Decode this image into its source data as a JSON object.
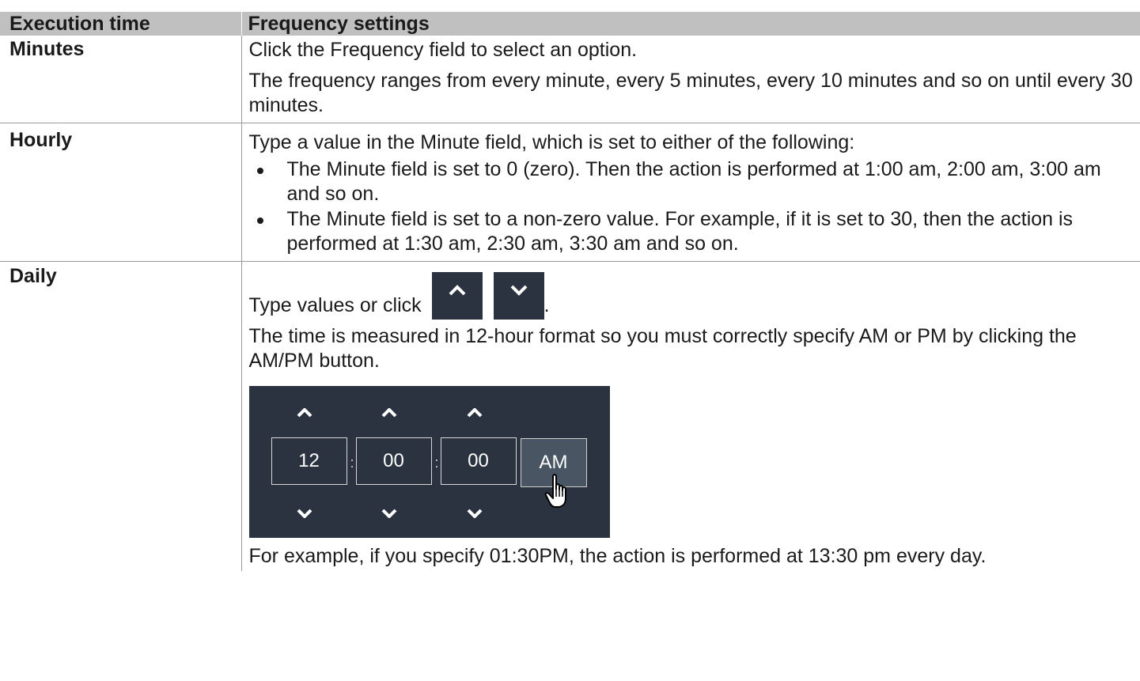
{
  "table": {
    "headers": [
      "Execution time",
      "Frequency settings"
    ],
    "rows": {
      "minutes": {
        "label": "Minutes",
        "p1": "Click the Frequency field to select an option.",
        "p2": "The frequency ranges from every minute, every 5 minutes, every 10 minutes and so on until every 30 minutes."
      },
      "hourly": {
        "label": "Hourly",
        "p1": "Type a value in the Minute field, which is set to either of the following:",
        "bullets": [
          "The Minute field is set to 0 (zero). Then the action is performed at 1:00 am, 2:00 am, 3:00 am and so on.",
          "The Minute field is set to a non-zero value. For example, if it is set to 30, then the action is performed at 1:30 am, 2:30 am, 3:30 am and so on."
        ]
      },
      "daily": {
        "label": "Daily",
        "p1_prefix": "Type values or click",
        "p1_suffix": ".",
        "p2": "The time is measured in 12-hour format so you must correctly specify AM or PM by clicking the AM/PM button.",
        "widget": {
          "hour": "12",
          "minute": "00",
          "second": "00",
          "ampm": "AM",
          "separator": ":",
          "icons": [
            "chevron-up-icon",
            "chevron-down-icon",
            "hand-cursor-icon"
          ]
        },
        "p3": "For example, if you specify 01:30PM, the action is performed at 13:30 pm every day."
      }
    }
  },
  "colors": {
    "header_bg": "#c0c0c0",
    "widget_bg": "#2b3340",
    "ampm_bg": "#4a5564"
  }
}
